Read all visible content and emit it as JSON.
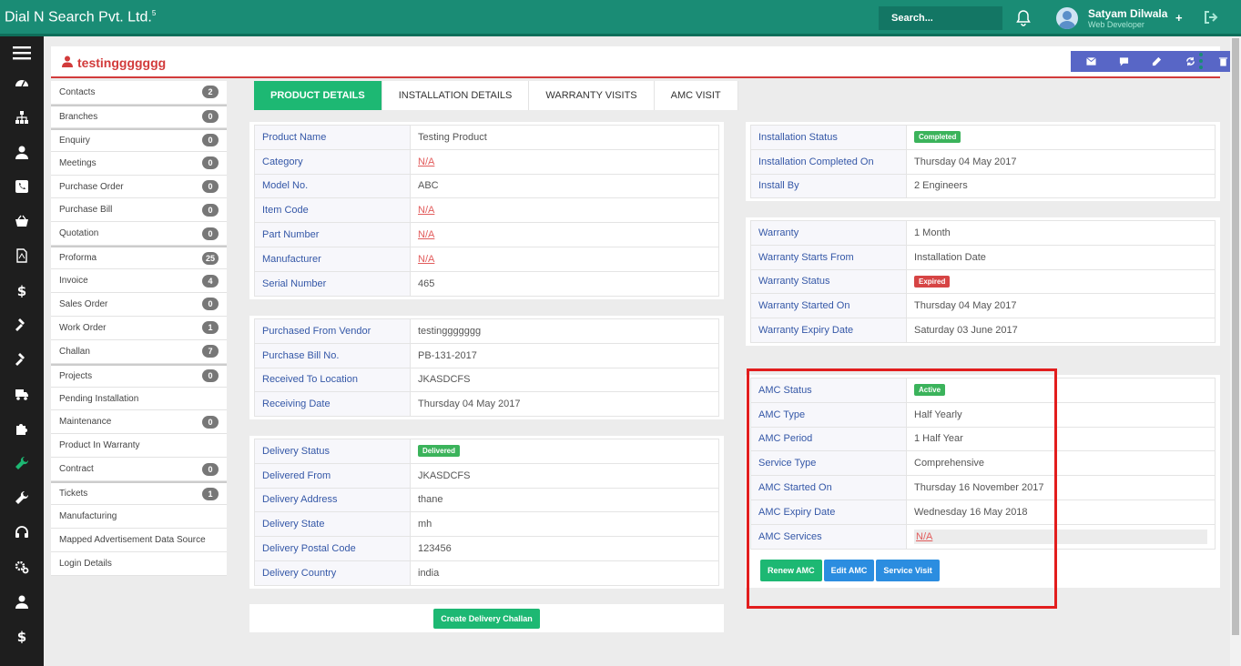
{
  "header": {
    "brand": "Dial N Search Pvt. Ltd.",
    "brand_sup": "5",
    "search_placeholder": "Search...",
    "user_name": "Satyam Dilwala",
    "user_role": "Web Developer"
  },
  "page": {
    "title": "testinggggggg"
  },
  "menu": {
    "items": [
      {
        "label": "Contacts",
        "count": "2"
      },
      {
        "label": "Branches",
        "count": "0"
      },
      {
        "label": "Enquiry",
        "count": "0"
      },
      {
        "label": "Meetings",
        "count": "0"
      },
      {
        "label": "Purchase Order",
        "count": "0"
      },
      {
        "label": "Purchase Bill",
        "count": "0"
      },
      {
        "label": "Quotation",
        "count": "0"
      },
      {
        "label": "Proforma",
        "count": "25"
      },
      {
        "label": "Invoice",
        "count": "4"
      },
      {
        "label": "Sales Order",
        "count": "0"
      },
      {
        "label": "Work Order",
        "count": "1"
      },
      {
        "label": "Challan",
        "count": "7"
      },
      {
        "label": "Projects",
        "count": "0"
      },
      {
        "label": "Pending Installation",
        "count": ""
      },
      {
        "label": "Maintenance",
        "count": "0"
      },
      {
        "label": "Product In Warranty",
        "count": ""
      },
      {
        "label": "Contract",
        "count": "0"
      },
      {
        "label": "Tickets",
        "count": "1"
      },
      {
        "label": "Manufacturing",
        "count": ""
      },
      {
        "label": "Mapped Advertisement Data Source",
        "count": ""
      },
      {
        "label": "Login Details",
        "count": ""
      }
    ]
  },
  "tabs": [
    "PRODUCT DETAILS",
    "INSTALLATION DETAILS",
    "WARRANTY VISITS",
    "AMC VISIT"
  ],
  "product": {
    "name_label": "Product Name",
    "name": "Testing Product",
    "category_label": "Category",
    "category": "N/A",
    "model_label": "Model No.",
    "model": "ABC",
    "item_code_label": "Item Code",
    "item_code": "N/A",
    "part_number_label": "Part Number",
    "part_number": "N/A",
    "manufacturer_label": "Manufacturer",
    "manufacturer": "N/A",
    "serial_label": "Serial Number",
    "serial": "465"
  },
  "purchase": {
    "vendor_label": "Purchased From Vendor",
    "vendor": "testinggggggg",
    "bill_label": "Purchase Bill No.",
    "bill": "PB-131-2017",
    "location_label": "Received To Location",
    "location": "JKASDCFS",
    "date_label": "Receiving Date",
    "date": "Thursday 04 May 2017"
  },
  "delivery": {
    "status_label": "Delivery Status",
    "status": "Delivered",
    "from_label": "Delivered From",
    "from": "JKASDCFS",
    "address_label": "Delivery Address",
    "address": "thane",
    "state_label": "Delivery State",
    "state": "mh",
    "postal_label": "Delivery Postal Code",
    "postal": "123456",
    "country_label": "Delivery Country",
    "country": "india",
    "challan_button": "Create Delivery Challan"
  },
  "installation": {
    "status_label": "Installation Status",
    "status": "Completed",
    "completed_label": "Installation Completed On",
    "completed": "Thursday 04 May 2017",
    "by_label": "Install By",
    "by": "2 Engineers"
  },
  "warranty": {
    "warranty_label": "Warranty",
    "warranty": "1 Month",
    "starts_label": "Warranty Starts From",
    "starts": "Installation Date",
    "status_label": "Warranty Status",
    "status": "Expired",
    "started_label": "Warranty Started On",
    "started": "Thursday 04 May 2017",
    "expiry_label": "Warranty Expiry Date",
    "expiry": "Saturday 03 June 2017"
  },
  "amc": {
    "status_label": "AMC Status",
    "status": "Active",
    "type_label": "AMC Type",
    "type": "Half Yearly",
    "period_label": "AMC Period",
    "period": "1 Half Year",
    "service_type_label": "Service Type",
    "service_type": "Comprehensive",
    "started_label": "AMC Started On",
    "started": "Thursday 16 November 2017",
    "expiry_label": "AMC Expiry Date",
    "expiry": "Wednesday 16 May 2018",
    "services_label": "AMC Services",
    "services": "N/A",
    "renew_button": "Renew AMC",
    "edit_button": "Edit AMC",
    "visit_button": "Service Visit"
  },
  "colors": {
    "topbar": "#1a8c75",
    "title": "#d23b3b",
    "tab_active": "#1db873",
    "highlight": "#e21d1d"
  }
}
